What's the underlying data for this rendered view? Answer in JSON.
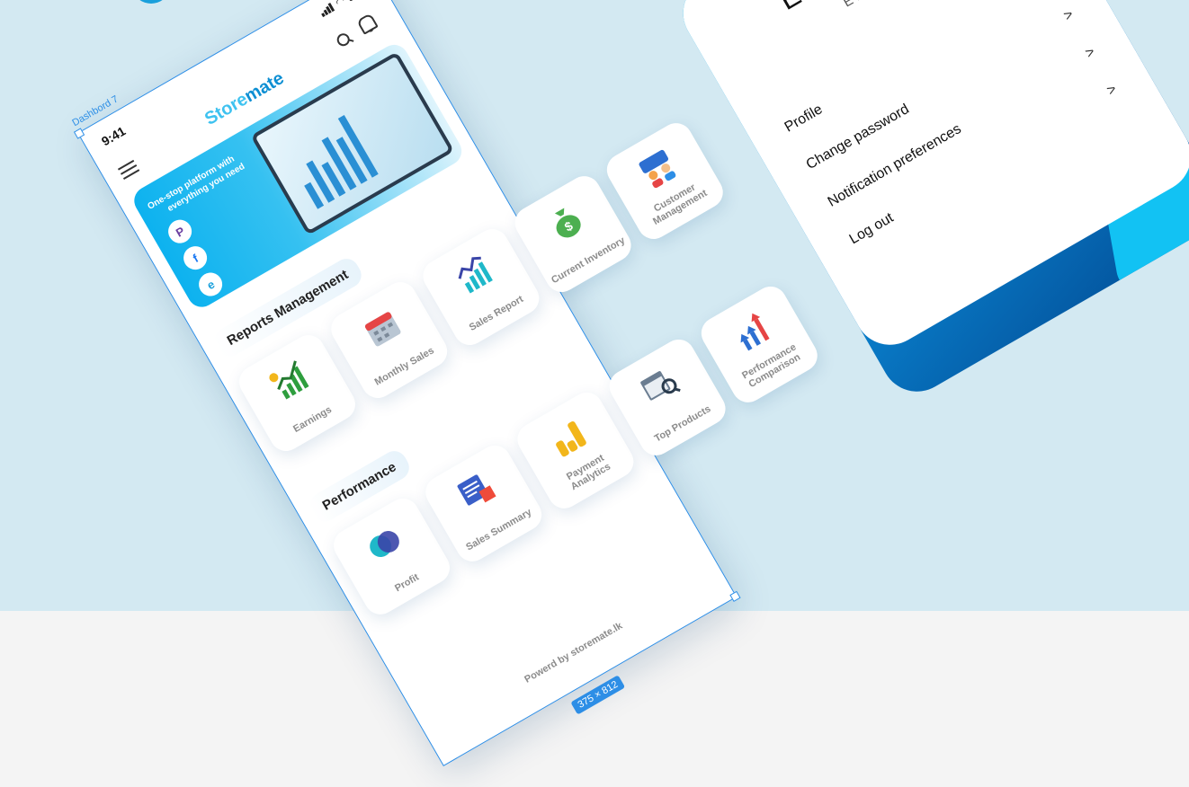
{
  "artboard": {
    "name": "Dashbord 7",
    "size": "375 × 812"
  },
  "status_bar": {
    "time": "9:41"
  },
  "header": {
    "logo_part1": "Store",
    "logo_part2": "mate",
    "icons": [
      "menu-icon",
      "search-icon",
      "bell-icon"
    ]
  },
  "banner": {
    "headline_line1": "One-stop platform with",
    "headline_line2": "everything you need",
    "socials": [
      {
        "icon": "payhere-icon",
        "glyph": "P"
      },
      {
        "icon": "facebook-icon",
        "glyph": "f"
      },
      {
        "icon": "browser-icon",
        "glyph": "e"
      }
    ]
  },
  "sections": {
    "reports": {
      "title": "Reports Management",
      "tiles": [
        {
          "label": "Earnings",
          "icon": "earnings-chart-icon"
        },
        {
          "label": "Monthly Sales",
          "icon": "calendar-icon"
        },
        {
          "label": "Sales Report",
          "icon": "sales-report-chart-icon"
        },
        {
          "label": "Current Inventory",
          "icon": "money-bag-icon"
        },
        {
          "label": "Customer Management",
          "icon": "customers-icon"
        }
      ]
    },
    "performance": {
      "title": "Performance",
      "tiles": [
        {
          "label": "Profit",
          "icon": "profit-circles-icon"
        },
        {
          "label": "Sales Summary",
          "icon": "sales-summary-icon"
        },
        {
          "label": "Payment Analytics",
          "icon": "coins-stack-icon"
        },
        {
          "label": "Top Products",
          "icon": "top-products-icon"
        },
        {
          "label": "Performance Comparison",
          "icon": "comparison-arrows-icon"
        }
      ]
    }
  },
  "footer": {
    "credit": "Powerd by storemate.lk"
  },
  "profile": {
    "name": "Emma Victoria",
    "store": "E Book Store",
    "menu": [
      {
        "label": "Profile",
        "chevron": ">"
      },
      {
        "label": "Change password",
        "chevron": ">"
      },
      {
        "label": "Notification preferences",
        "chevron": ">"
      },
      {
        "label": "Log out",
        "chevron": ">"
      }
    ]
  },
  "colors": {
    "accent": "#17a7e0",
    "background": "#d3e9f2",
    "selection": "#2d8ee6"
  }
}
